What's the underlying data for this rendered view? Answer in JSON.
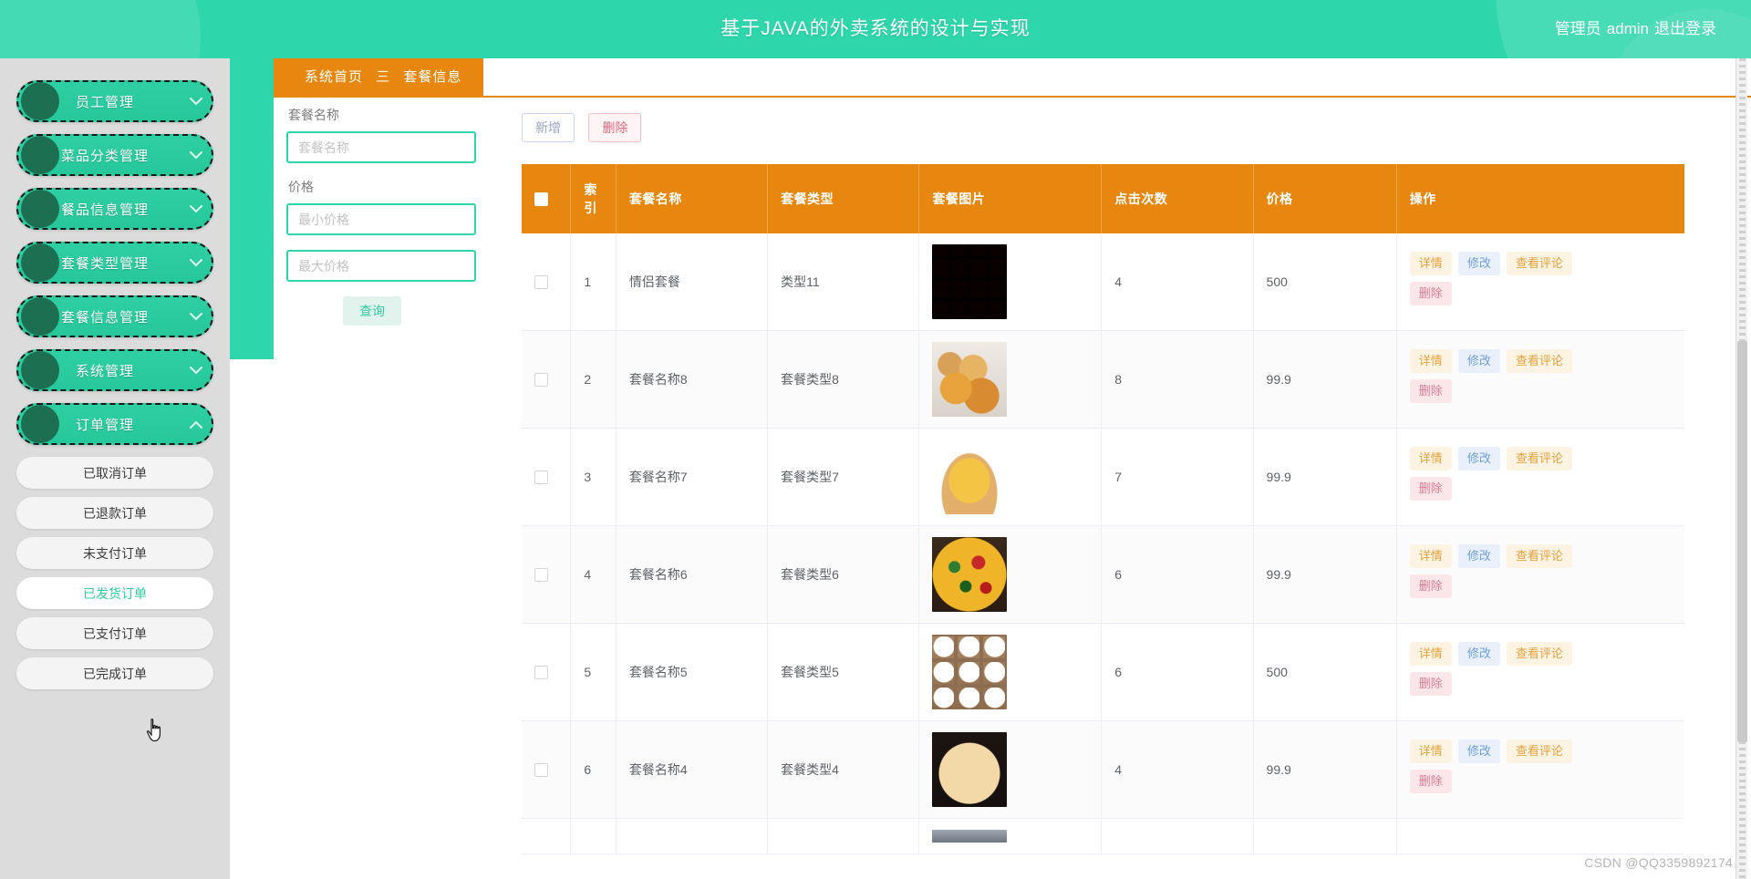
{
  "header": {
    "title": "基于JAVA的外卖系统的设计与实现",
    "role_label": "管理员",
    "admin_name": "admin",
    "logout_label": "退出登录"
  },
  "sidebar": {
    "main_items": [
      {
        "label": "员工管理",
        "expanded": false
      },
      {
        "label": "菜品分类管理",
        "expanded": false
      },
      {
        "label": "餐品信息管理",
        "expanded": false
      },
      {
        "label": "套餐类型管理",
        "expanded": false
      },
      {
        "label": "套餐信息管理",
        "expanded": false
      },
      {
        "label": "系统管理",
        "expanded": false
      },
      {
        "label": "订单管理",
        "expanded": true
      }
    ],
    "submenu_items": [
      {
        "label": "已取消订单",
        "hovered": false
      },
      {
        "label": "已退款订单",
        "hovered": false
      },
      {
        "label": "未支付订单",
        "hovered": false
      },
      {
        "label": "已发货订单",
        "hovered": true
      },
      {
        "label": "已支付订单",
        "hovered": false
      },
      {
        "label": "已完成订单",
        "hovered": false
      }
    ]
  },
  "breadcrumb": {
    "home": "系统首页",
    "separator": "三",
    "current": "套餐信息"
  },
  "search": {
    "name_label": "套餐名称",
    "name_placeholder": "套餐名称",
    "name_value": "",
    "price_label": "价格",
    "price_min_placeholder": "最小价格",
    "price_min_value": "",
    "price_max_placeholder": "最大价格",
    "price_max_value": "",
    "query_label": "查询"
  },
  "toolbar": {
    "add_label": "新增",
    "delete_label": "删除"
  },
  "table": {
    "columns": [
      {
        "key": "check",
        "label": ""
      },
      {
        "key": "index",
        "label": "索 引"
      },
      {
        "key": "name",
        "label": "套餐名称"
      },
      {
        "key": "type",
        "label": "套餐类型"
      },
      {
        "key": "image",
        "label": "套餐图片"
      },
      {
        "key": "clicks",
        "label": "点击次数"
      },
      {
        "key": "price",
        "label": "价格"
      },
      {
        "key": "ops",
        "label": "操作"
      }
    ],
    "row_actions": [
      {
        "label": "详情",
        "style": "op-detail"
      },
      {
        "label": "修改",
        "style": "op-edit"
      },
      {
        "label": "查看评论",
        "style": "op-comment"
      },
      {
        "label": "删除",
        "style": "op-delete"
      }
    ],
    "rows": [
      {
        "index": "1",
        "name": "情侣套餐",
        "type": "类型11",
        "clicks": "4",
        "price": "500",
        "img": "img-1"
      },
      {
        "index": "2",
        "name": "套餐名称8",
        "type": "套餐类型8",
        "clicks": "8",
        "price": "99.9",
        "img": "img-2"
      },
      {
        "index": "3",
        "name": "套餐名称7",
        "type": "套餐类型7",
        "clicks": "7",
        "price": "99.9",
        "img": "img-3"
      },
      {
        "index": "4",
        "name": "套餐名称6",
        "type": "套餐类型6",
        "clicks": "6",
        "price": "99.9",
        "img": "img-4"
      },
      {
        "index": "5",
        "name": "套餐名称5",
        "type": "套餐类型5",
        "clicks": "6",
        "price": "500",
        "img": "img-5"
      },
      {
        "index": "6",
        "name": "套餐名称4",
        "type": "套餐类型4",
        "clicks": "4",
        "price": "99.9",
        "img": "img-6"
      }
    ]
  },
  "watermark": "CSDN @QQ3359892174",
  "colors": {
    "brand_green": "#2ed6ac",
    "menu_green": "#2ecfa2",
    "menu_bullet": "#1d6f52",
    "accent_orange": "#e8870f",
    "sidebar_bg": "#dcdcdc"
  }
}
